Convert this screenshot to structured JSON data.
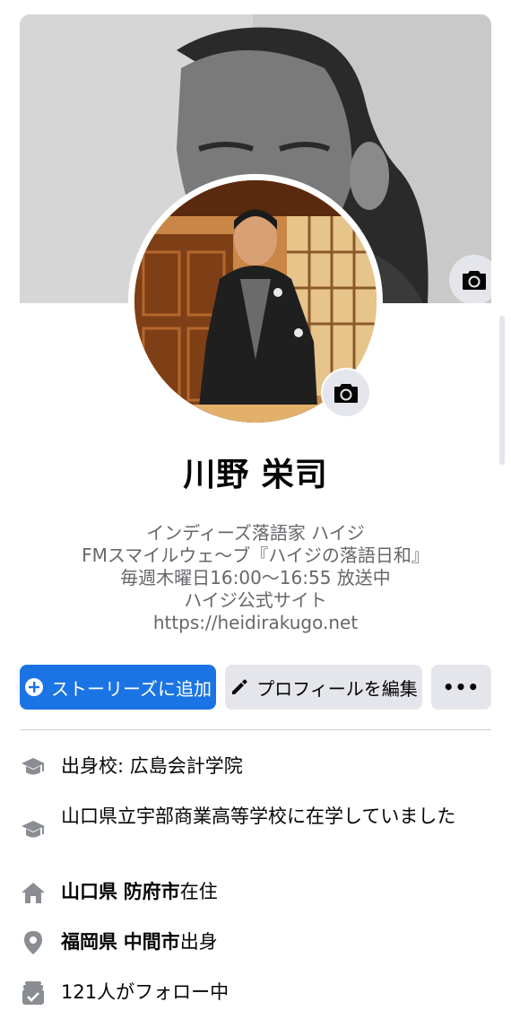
{
  "profile": {
    "name": "川野 栄司"
  },
  "bio": {
    "lines": [
      "インディーズ落語家 ハイジ",
      "FMスマイルウェ～ブ『ハイジの落語日和』",
      "毎週木曜日16:00～16:55 放送中",
      "ハイジ公式サイト",
      "https://heidirakugo.net"
    ]
  },
  "actions": {
    "add_story": "ストーリーズに追加",
    "edit_profile": "プロフィールを編集",
    "more": "•••"
  },
  "info": {
    "school_prefix": "出身校: ",
    "school_name": "広島会計学院",
    "high_school": "山口県立宇部商業高等学校に在学していました",
    "residence_pref": "山口県",
    "residence_city": "防府市",
    "residence_suffix": "在住",
    "hometown_pref": "福岡県",
    "hometown_city": "中間市",
    "hometown_suffix": "出身",
    "followers": "121人がフォロー中"
  },
  "icons": {
    "cover_camera": "camera-icon",
    "avatar_camera": "camera-icon",
    "add": "plus-circle-icon",
    "edit": "pencil-icon",
    "school": "graduation-cap-icon",
    "home": "house-icon",
    "location": "map-pin-icon",
    "followers": "followers-icon"
  },
  "colors": {
    "primary": "#1b74e4",
    "secondary_bg": "#e4e6eb",
    "text": "#050505",
    "muted": "#65676b",
    "icon": "#8a8d91"
  }
}
